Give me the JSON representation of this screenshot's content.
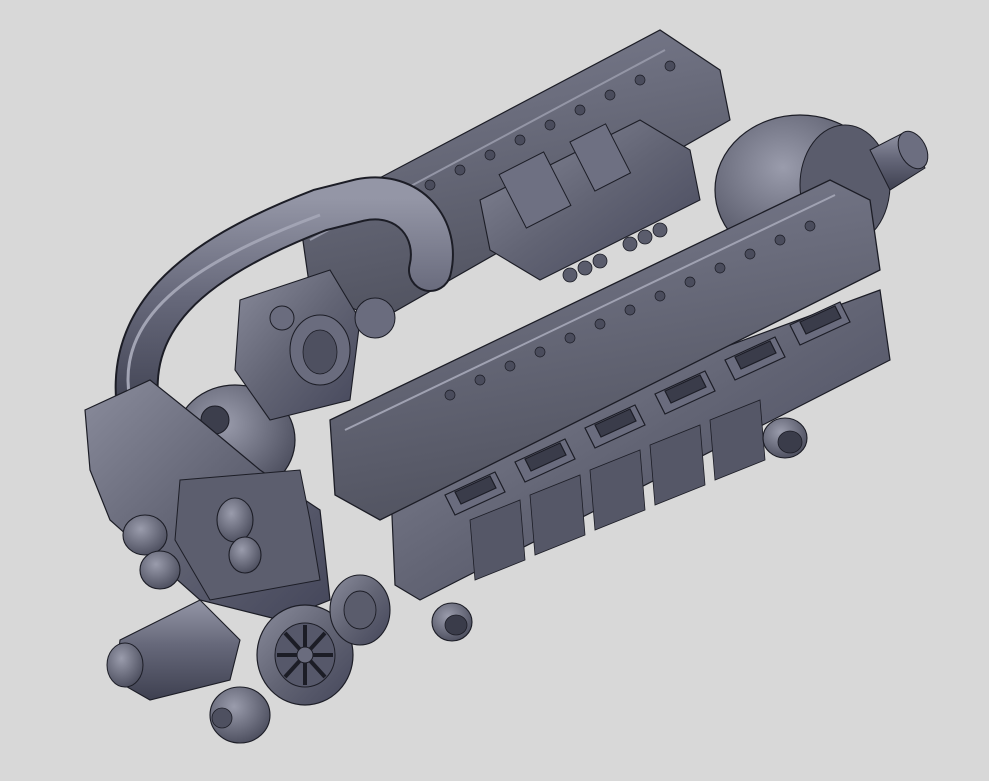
{
  "viewport": {
    "background_color": "#d8d8d8"
  },
  "model": {
    "body_color": "#5e6070",
    "highlight_color": "#8a8c9c",
    "shadow_color": "#3e4050",
    "edge_color": "#1c1d26",
    "icon": "v12-aircraft-engine-3d-model"
  }
}
